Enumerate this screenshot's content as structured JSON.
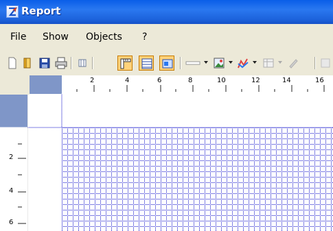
{
  "window": {
    "title": "Report",
    "icon": "report-app-icon"
  },
  "menu": {
    "items": [
      {
        "label": "File"
      },
      {
        "label": "Show"
      },
      {
        "label": "Objects"
      },
      {
        "label": "?"
      }
    ]
  },
  "toolbar": {
    "buttons": [
      {
        "icon": "new-page-icon"
      },
      {
        "icon": "open-book-icon"
      },
      {
        "icon": "save-icon"
      },
      {
        "icon": "print-icon"
      },
      {
        "icon": "columns-icon"
      },
      {
        "icon": "ruler-icon",
        "active": true
      },
      {
        "icon": "grid-icon",
        "active": true
      },
      {
        "icon": "fields-icon",
        "active": true
      },
      {
        "icon": "line-icon"
      },
      {
        "icon": "image-icon"
      },
      {
        "icon": "chart-icon"
      },
      {
        "icon": "table-icon"
      },
      {
        "icon": "pencil-icon"
      }
    ]
  },
  "ruler": {
    "h_labels": [
      "2",
      "4",
      "6",
      "8",
      "10",
      "12",
      "14",
      "16"
    ],
    "v_labels": [
      "2",
      "4",
      "6"
    ]
  },
  "colors": {
    "title_bar": "#1d63dc",
    "ruler_band": "#7f96c8",
    "grid_line": "#0000c8",
    "active_button": "#ffd27a"
  }
}
